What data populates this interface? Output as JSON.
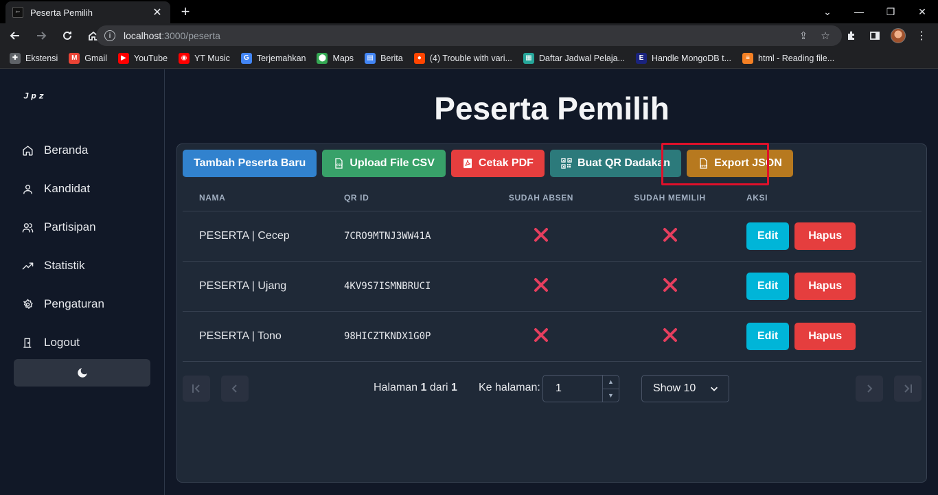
{
  "browser": {
    "tab_title": "Peserta Pemilih",
    "tab_favicon_text": "ᴶᵖᶻ",
    "url_host": "localhost",
    "url_rest": ":3000/peserta",
    "bookmarks": [
      {
        "label": "Ekstensi",
        "icon": "puzzle-icon",
        "color": "#5f6368"
      },
      {
        "label": "Gmail",
        "icon": "gmail-icon",
        "color": "#ea4335"
      },
      {
        "label": "YouTube",
        "icon": "youtube-icon",
        "color": "#ff0000"
      },
      {
        "label": "YT Music",
        "icon": "yt-music-icon",
        "color": "#ff0000"
      },
      {
        "label": "Terjemahkan",
        "icon": "translate-icon",
        "color": "#4285f4"
      },
      {
        "label": "Maps",
        "icon": "maps-icon",
        "color": "#34a853"
      },
      {
        "label": "Berita",
        "icon": "news-icon",
        "color": "#4285f4"
      },
      {
        "label": "(4) Trouble with vari...",
        "icon": "reddit-icon",
        "color": "#ff4500"
      },
      {
        "label": "Daftar Jadwal Pelaja...",
        "icon": "sheet-icon",
        "color": "#26a69a"
      },
      {
        "label": "Handle MongoDB t...",
        "icon": "e-icon",
        "color": "#1a237e"
      },
      {
        "label": "html - Reading file...",
        "icon": "stackoverflow-icon",
        "color": "#f48024"
      }
    ]
  },
  "sidebar": {
    "logo": "ᴶᵖᶻ",
    "items": [
      {
        "label": "Beranda",
        "icon": "home-icon"
      },
      {
        "label": "Kandidat",
        "icon": "user-icon"
      },
      {
        "label": "Partisipan",
        "icon": "users-icon"
      },
      {
        "label": "Statistik",
        "icon": "trending-icon"
      },
      {
        "label": "Pengaturan",
        "icon": "gear-icon"
      },
      {
        "label": "Logout",
        "icon": "logout-icon"
      }
    ],
    "theme_icon": "moon-icon"
  },
  "page": {
    "title": "Peserta Pemilih",
    "actions": {
      "add": "Tambah Peserta Baru",
      "upload": "Upload File CSV",
      "pdf": "Cetak PDF",
      "qr": "Buat QR Dadakan",
      "export": "Export JSON"
    },
    "colors": {
      "add": "#3182ce",
      "upload": "#38a169",
      "pdf": "#e53e3e",
      "qr": "#2c7a7b",
      "export": "#b7791f",
      "highlight": "#e0102a"
    }
  },
  "table": {
    "headers": {
      "nama": "NAMA",
      "qr": "QR ID",
      "absen": "SUDAH ABSEN",
      "memilih": "SUDAH MEMILIH",
      "aksi": "AKSI"
    },
    "rows": [
      {
        "nama": "PESERTA | Cecep",
        "qr": "7CRO9MTNJ3WW41A",
        "absen": false,
        "memilih": false
      },
      {
        "nama": "PESERTA | Ujang",
        "qr": "4KV9S7ISMNBRUCI",
        "absen": false,
        "memilih": false
      },
      {
        "nama": "PESERTA | Tono",
        "qr": "98HICZTKNDX1G0P",
        "absen": false,
        "memilih": false
      }
    ],
    "edit_label": "Edit",
    "delete_label": "Hapus"
  },
  "pagination": {
    "halaman_label": "Halaman",
    "current": "1",
    "dari_label": "dari",
    "total": "1",
    "goto_label": "Ke halaman:",
    "goto_value": "1",
    "show_label": "Show 10"
  }
}
